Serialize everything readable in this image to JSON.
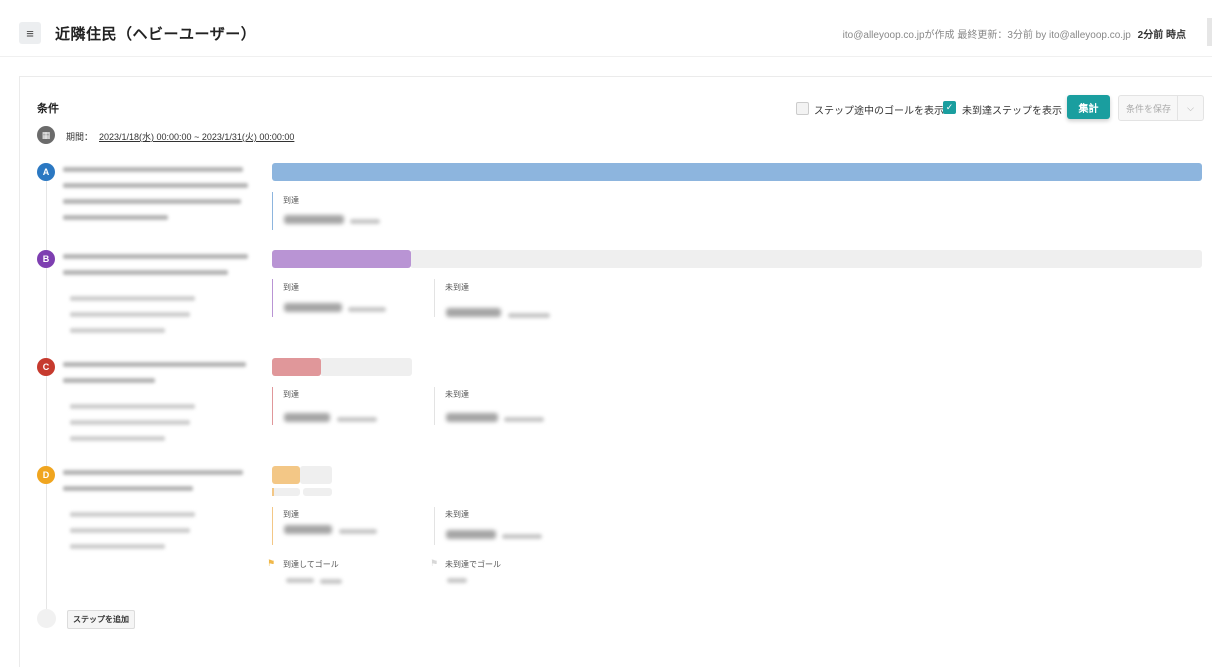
{
  "header": {
    "menu_icon": "hamburger-icon",
    "title": "近隣住民（ヘビーユーザー）",
    "meta_text": "ito@alleyoop.co.jpが作成  最終更新：3分前 by ito@alleyoop.co.jp",
    "meta_time": "2分前 時点"
  },
  "conditions": {
    "title": "条件",
    "show_mid_goal_label": "ステップ途中のゴールを表示",
    "show_mid_goal_checked": false,
    "show_unreached_label": "未到達ステップを表示",
    "show_unreached_checked": true,
    "run_button": "集計",
    "save_button": "条件を保存",
    "period_label": "期間：",
    "period_value": "2023/1/18(水) 00:00:00 ~ 2023/1/31(火) 00:00:00"
  },
  "colors": {
    "accent": "#1a9e9f",
    "step_a": "#2b78c2",
    "step_b": "#7e3fb1",
    "step_c": "#c63a2e",
    "step_d": "#f0a51f",
    "bar_a": "#8db5de",
    "bar_b": "#b994d4",
    "bar_c": "#e0979a",
    "bar_d": "#f3c786"
  },
  "steps": [
    {
      "id": "A",
      "reached_label": "到達",
      "reached_fraction": 1.0
    },
    {
      "id": "B",
      "reached_label": "到達",
      "unreached_label": "未到達",
      "reached_fraction": 0.148
    },
    {
      "id": "C",
      "reached_label": "到達",
      "unreached_label": "未到達",
      "reached_fraction": 0.35
    },
    {
      "id": "D",
      "reached_label": "到達",
      "unreached_label": "未到達",
      "reached_fraction": 0.5,
      "goal_reached_label": "到達してゴール",
      "goal_unreached_label": "未到達でゴール"
    }
  ],
  "add_step_button": "ステップを追加"
}
